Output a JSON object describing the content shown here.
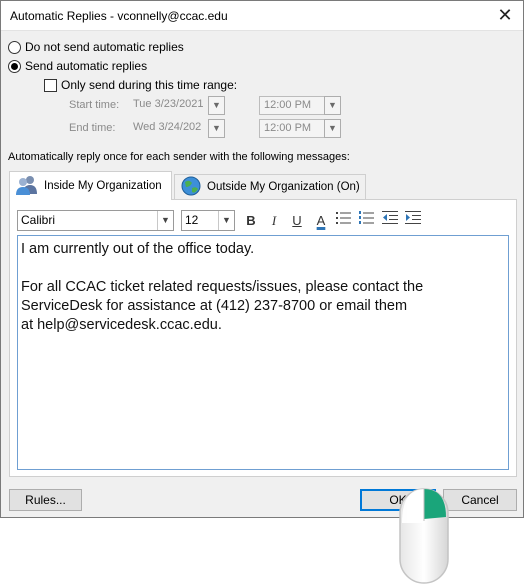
{
  "window": {
    "title": "Automatic Replies - vconnelly@ccac.edu",
    "close_glyph": "✕"
  },
  "options": {
    "no_reply_label": "Do not send automatic replies",
    "send_reply_label": "Send automatic replies",
    "selected": "send_reply",
    "time_range_label": "Only send during this time range:",
    "time_range_checked": false,
    "start_label": "Start time:",
    "start_date": "Tue 3/23/2021",
    "start_time": "12:00 PM",
    "end_label": "End time:",
    "end_date": "Wed 3/24/202",
    "end_time": "12:00 PM"
  },
  "instructions": "Automatically reply once for each sender with the following messages:",
  "tabs": [
    {
      "label": "Inside My Organization",
      "icon": "people-icon",
      "active": true
    },
    {
      "label": "Outside My Organization (On)",
      "icon": "globe-icon",
      "active": false
    }
  ],
  "toolbar": {
    "font": "Calibri",
    "size": "12",
    "bold": "B",
    "italic": "I",
    "underline": "U",
    "font_color": "A",
    "font_color_hex": "#2e75b6"
  },
  "message": {
    "line1": "I am currently out of the office today.",
    "line2": "For all CCAC ticket related requests/issues, please contact the",
    "line3": "ServiceDesk for assistance at (412) 237-8700 or email them",
    "line4": "at help@servicedesk.ccac.edu."
  },
  "buttons": {
    "rules": "Rules...",
    "ok": "OK",
    "cancel": "Cancel"
  },
  "colors": {
    "accent": "#0078d7",
    "mouse_accent": "#1aa57a"
  }
}
